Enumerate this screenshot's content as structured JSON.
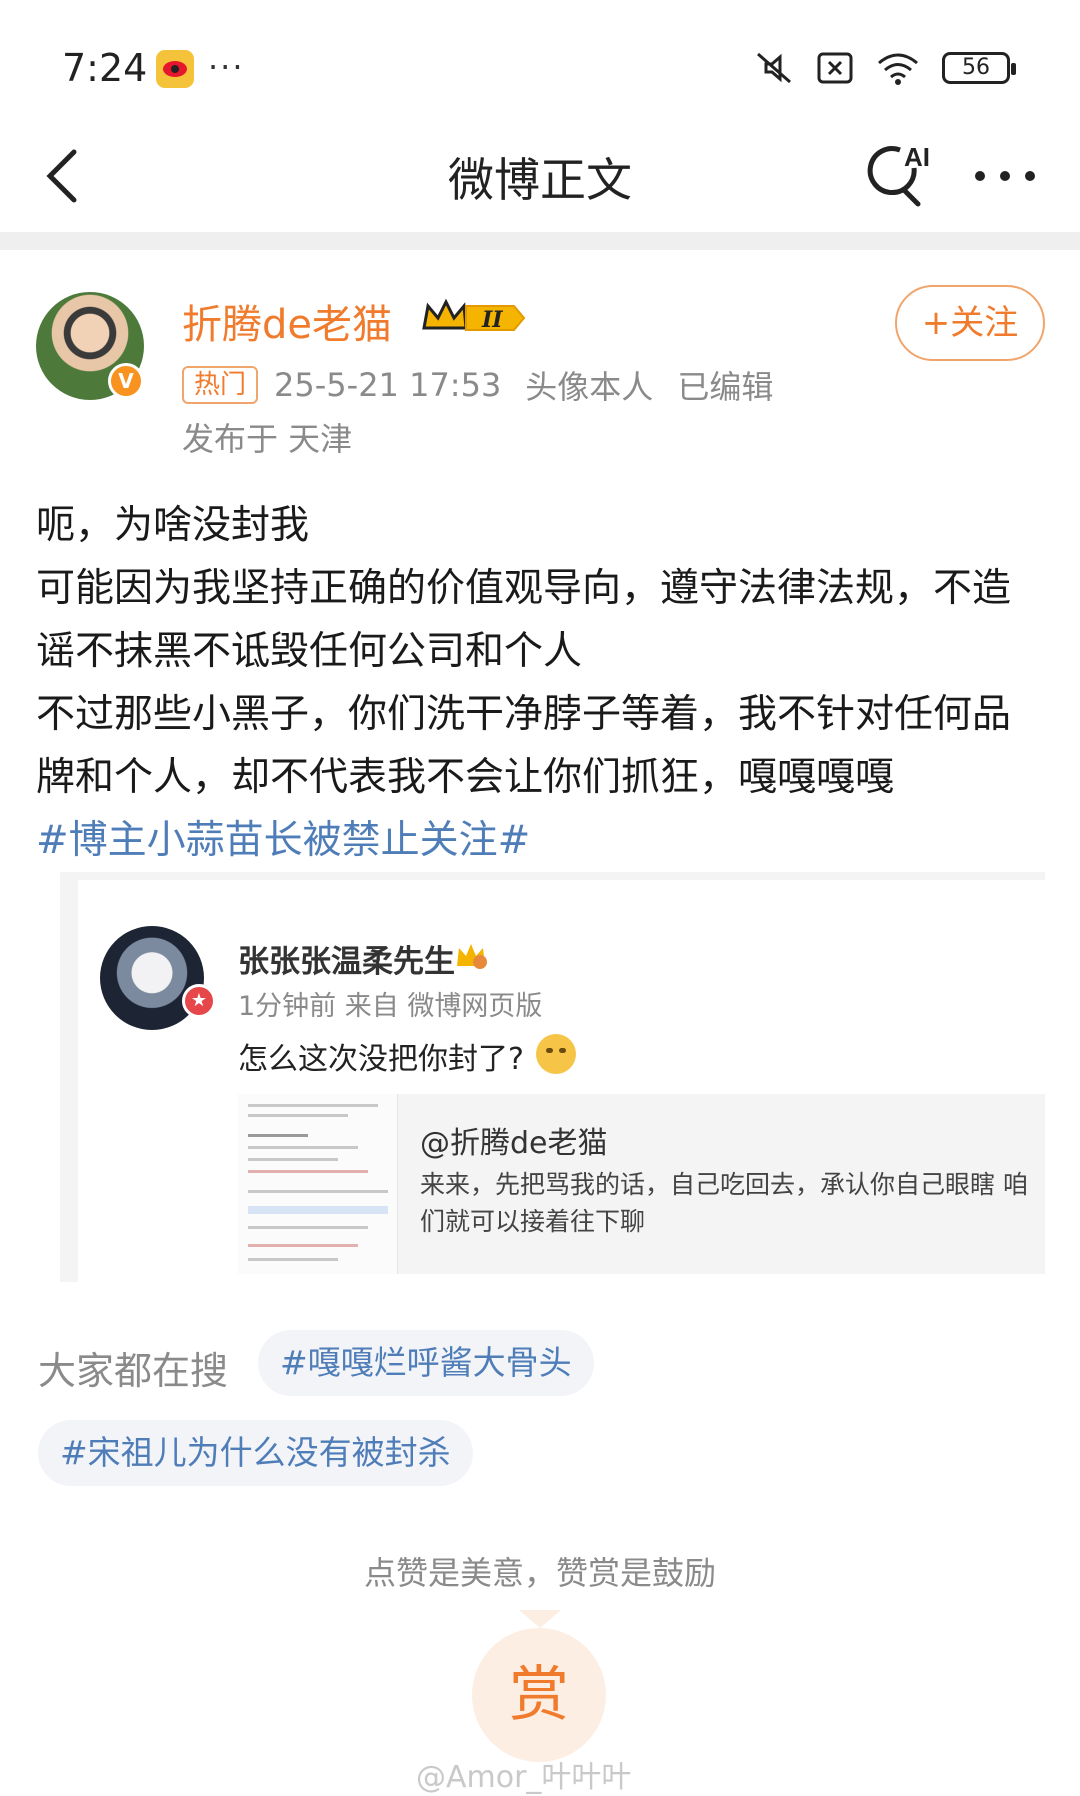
{
  "status_bar": {
    "time": "7:24",
    "battery": "56",
    "more": "···"
  },
  "header": {
    "title": "微博正文",
    "ai_label": "AI",
    "more_icon": "more-icon"
  },
  "post": {
    "author": "折腾de老猫",
    "level_badge": "II",
    "follow_label": "+关注",
    "hot_tag": "热门",
    "datetime": "25-5-21 17:53",
    "avatar_note": "头像本人",
    "edited": "已编辑",
    "location": "发布于 天津",
    "paragraphs": [
      "呃，为啥没封我",
      "可能因为我坚持正确的价值观导向，遵守法律法规，不造谣不抹黑不诋毁任何公司和个人",
      "不过那些小黑子，你们洗干净脖子等着，我不针对任何品牌和个人，却不代表我不会让你们抓狂，嘎嘎嘎嘎"
    ],
    "hashtag": "#博主小蒜苗长被禁止关注#"
  },
  "quoted": {
    "name": "张张张温柔先生",
    "meta": "1分钟前  来自 微博网页版",
    "text": "怎么这次没把你封了?",
    "card_title": "@折腾de老猫",
    "card_text": "来来，先把骂我的话，自己吃回去，承认你自己眼瞎 咱们就可以接着往下聊"
  },
  "search": {
    "label": "大家都在搜",
    "chips": [
      "#嘎嘎烂呼酱大骨头",
      "#宋祖儿为什么没有被封杀"
    ]
  },
  "reward": {
    "caption": "点赞是美意，赞赏是鼓励",
    "button": "赏"
  },
  "watermark": "@Amor_叶叶叶",
  "colors": {
    "accent": "#f07b2c",
    "link": "#4f7db8",
    "muted": "#8a8a8a"
  }
}
